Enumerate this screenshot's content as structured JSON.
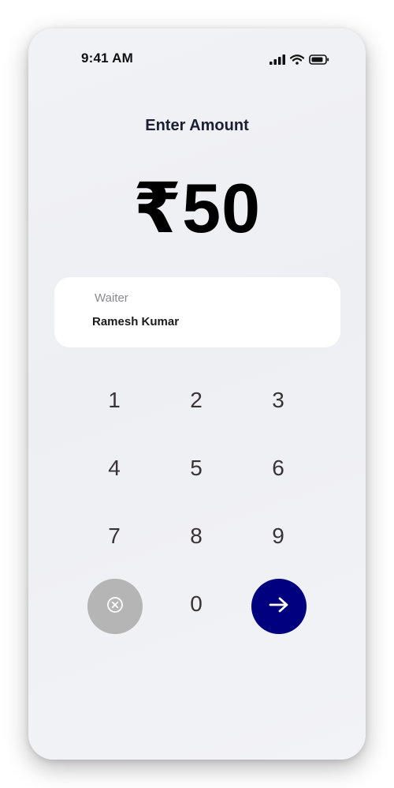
{
  "status_bar": {
    "time": "9:41 AM",
    "icons": [
      "signal-icon",
      "wifi-icon",
      "battery-icon"
    ]
  },
  "screen": {
    "title": "Enter Amount",
    "amount": "₹50"
  },
  "waiter": {
    "label": "Waiter",
    "name": "Ramesh Kumar"
  },
  "keypad": {
    "keys": [
      "1",
      "2",
      "3",
      "4",
      "5",
      "6",
      "7",
      "8",
      "9",
      "0"
    ],
    "clear_icon": "clear-icon",
    "next_icon": "arrow-right-icon"
  },
  "colors": {
    "primary_button": "#010180",
    "clear_button": "#b5b5b5",
    "background": "#f0f1f5",
    "card": "#ffffff"
  }
}
